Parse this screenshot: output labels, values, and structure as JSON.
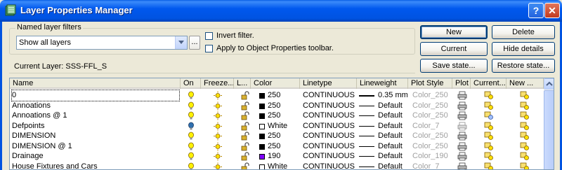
{
  "window": {
    "title": "Layer Properties Manager",
    "help_label": "?",
    "close_label": "✕"
  },
  "filters": {
    "group_label": "Named layer filters",
    "selected": "Show all layers",
    "browse_label": "...",
    "invert_label": "Invert filter.",
    "apply_label": "Apply to Object Properties toolbar."
  },
  "current_layer": "Current Layer:  SSS-FFL_S",
  "buttons": {
    "new": "New",
    "delete": "Delete",
    "current": "Current",
    "hide_details": "Hide details",
    "save_state": "Save state...",
    "restore_state": "Restore state..."
  },
  "columns": [
    "Name",
    "On",
    "Freeze...",
    "L...",
    "Color",
    "Linetype",
    "Lineweight",
    "Plot Style",
    "Plot",
    "Current...",
    "New ..."
  ],
  "layers": [
    {
      "name": "0",
      "on": "on",
      "color_hex": "#000000",
      "color": "250",
      "linetype": "CONTINUOUS",
      "lineweight": "0.35 mm",
      "lw_heavy": true,
      "plot_style": "Color_250",
      "plot": "plot",
      "current_vp": "normal",
      "new_vp": "normal"
    },
    {
      "name": "Annoations",
      "on": "on",
      "color_hex": "#000000",
      "color": "250",
      "linetype": "CONTINUOUS",
      "lineweight": "Default",
      "lw_heavy": false,
      "plot_style": "Color_250",
      "plot": "plot",
      "current_vp": "normal",
      "new_vp": "normal"
    },
    {
      "name": "Annoations @ 1",
      "on": "on",
      "color_hex": "#000000",
      "color": "250",
      "linetype": "CONTINUOUS",
      "lineweight": "Default",
      "lw_heavy": false,
      "plot_style": "Color_250",
      "plot": "plot",
      "current_vp": "frozen",
      "new_vp": "normal"
    },
    {
      "name": "Defpoints",
      "on": "off",
      "color_hex": "#FFFFFF",
      "color": "White",
      "linetype": "CONTINUOUS",
      "lineweight": "Default",
      "lw_heavy": false,
      "plot_style": "Color_7",
      "plot": "noplot",
      "current_vp": "normal",
      "new_vp": "normal"
    },
    {
      "name": "DIMENSION",
      "on": "on",
      "color_hex": "#000000",
      "color": "250",
      "linetype": "CONTINUOUS",
      "lineweight": "Default",
      "lw_heavy": false,
      "plot_style": "Color_250",
      "plot": "plot",
      "current_vp": "normal",
      "new_vp": "normal"
    },
    {
      "name": "DIMENSION @ 1",
      "on": "on",
      "color_hex": "#000000",
      "color": "250",
      "linetype": "CONTINUOUS",
      "lineweight": "Default",
      "lw_heavy": false,
      "plot_style": "Color_250",
      "plot": "plot",
      "current_vp": "normal",
      "new_vp": "normal"
    },
    {
      "name": "Drainage",
      "on": "on",
      "color_hex": "#8000FF",
      "color": "190",
      "linetype": "CONTINUOUS",
      "lineweight": "Default",
      "lw_heavy": false,
      "plot_style": "Color_190",
      "plot": "plot",
      "current_vp": "normal",
      "new_vp": "normal"
    },
    {
      "name": "House Fixtures and Cars",
      "on": "on",
      "color_hex": "#FFFFFF",
      "color": "White",
      "linetype": "CONTINUOUS",
      "lineweight": "Default",
      "lw_heavy": false,
      "plot_style": "Color_7",
      "plot": "plot",
      "current_vp": "normal",
      "new_vp": "normal"
    }
  ]
}
